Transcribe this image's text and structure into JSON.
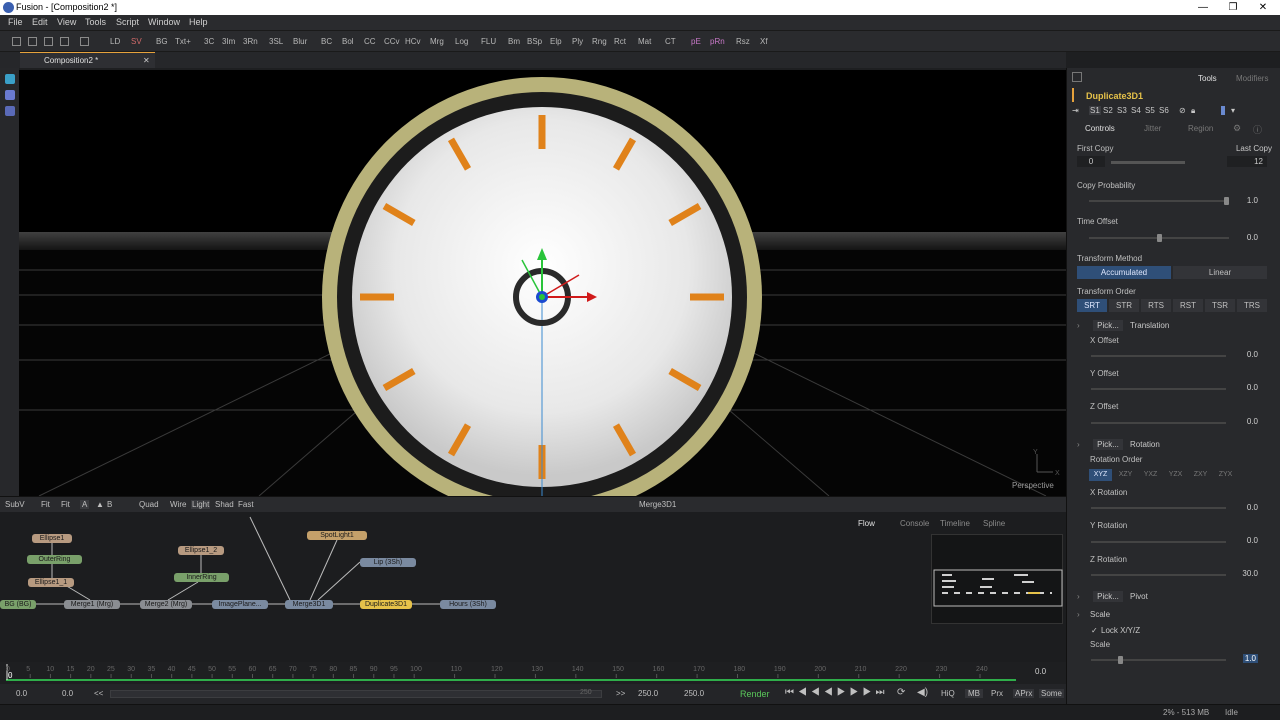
{
  "window": {
    "title": "Fusion - [Composition2 *]",
    "controls": [
      "—",
      "❐",
      "✕"
    ]
  },
  "menu": [
    "File",
    "Edit",
    "View",
    "Tools",
    "Script",
    "Window",
    "Help"
  ],
  "toolbar": [
    "LD",
    "SV",
    "BG",
    "Txt+",
    "3C",
    "3Im",
    "3Rn",
    "3SL",
    "Blur",
    "BC",
    "Bol",
    "CC",
    "CCv",
    "HCv",
    "Mrg",
    "Log",
    "FLU",
    "Bm",
    "BSp",
    "Elp",
    "Ply",
    "Rng",
    "Rct",
    "Mat",
    "CT",
    "pE",
    "pRn",
    "Rsz",
    "Xf"
  ],
  "tab": {
    "label": "Composition2 *",
    "close": "✕"
  },
  "viewport": {
    "mode_label": "Perspective",
    "axis_y": "Y",
    "axis_x": "X"
  },
  "viewer_bar": {
    "subv": "SubV",
    "fit": "Fit",
    "a": "A",
    "b": "B",
    "quad": "Quad",
    "wire": "Wire",
    "light": "Light",
    "shad": "Shad",
    "fast": "Fast",
    "view_name": "Merge3D1"
  },
  "flow": {
    "tabs": {
      "flow": "Flow",
      "console": "Console",
      "timeline": "Timeline",
      "spline": "Spline"
    },
    "nodes": {
      "ellipse1": "Ellipse1",
      "outer_ring": "OuterRing",
      "ellipse1_1": "Ellipse1_1",
      "bg": "BG (BG)",
      "merge1": "Merge1 (Mrg)",
      "ellipse1_2": "Ellipse1_2",
      "inner_ring": "InnerRing",
      "merge2": "Merge2 (Mrg)",
      "image_plane": "ImagePlane...",
      "spotlight": "SpotLight1",
      "lip": "Lip (3Sh)",
      "merge3d": "Merge3D1",
      "duplicate3d": "Duplicate3D1",
      "hours": "Hours (3Sh)"
    }
  },
  "timeline": {
    "ticks": [
      "0",
      "5",
      "10",
      "15",
      "20",
      "25",
      "30",
      "35",
      "40",
      "45",
      "50",
      "55",
      "60",
      "65",
      "70",
      "75",
      "80",
      "85",
      "90",
      "95",
      "100",
      "110",
      "120",
      "130",
      "140",
      "150",
      "160",
      "170",
      "180",
      "190",
      "200",
      "210",
      "220",
      "230",
      "240"
    ],
    "current": "0.0",
    "current_marker": "0"
  },
  "transport": {
    "start": "0.0",
    "global_start": "0.0",
    "rew": "<<",
    "range_end_label": "250",
    "fwd": ">>",
    "render_end": "250.0",
    "global_end": "250.0",
    "render": "Render",
    "hiq": "HiQ",
    "mb": "MB",
    "prx": "Prx",
    "aprx": "APrx",
    "some": "Some"
  },
  "status": {
    "memory": "2% - 513 MB",
    "state": "Idle"
  },
  "panel": {
    "tabs": {
      "tools": "Tools",
      "modifiers": "Modifiers"
    },
    "tool_name": "Duplicate3D1",
    "slots": [
      "S1",
      "S2",
      "S3",
      "S4",
      "S5",
      "S6"
    ],
    "subtabs": {
      "controls": "Controls",
      "jitter": "Jitter",
      "region": "Region"
    },
    "first_copy": {
      "label": "First Copy",
      "value": "0"
    },
    "last_copy": {
      "label": "Last Copy",
      "value": "12"
    },
    "copy_probability": {
      "label": "Copy Probability",
      "value": "1.0",
      "fraction": 1.0
    },
    "time_offset": {
      "label": "Time Offset",
      "value": "0.0",
      "fraction": 0.5
    },
    "transform_method": {
      "label": "Transform Method",
      "options": [
        "Accumulated",
        "Linear"
      ],
      "selected": "Accumulated"
    },
    "transform_order": {
      "label": "Transform Order",
      "options": [
        "SRT",
        "STR",
        "RTS",
        "RST",
        "TSR",
        "TRS"
      ],
      "selected": "SRT"
    },
    "translation": {
      "pick": "Pick...",
      "title": "Translation",
      "x": {
        "label": "X Offset",
        "value": "0.0"
      },
      "y": {
        "label": "Y Offset",
        "value": "0.0"
      },
      "z": {
        "label": "Z Offset",
        "value": "0.0"
      }
    },
    "rotation": {
      "pick": "Pick...",
      "title": "Rotation",
      "order_label": "Rotation Order",
      "orders": [
        "XYZ",
        "XZY",
        "YXZ",
        "YZX",
        "ZXY",
        "ZYX"
      ],
      "selected": "XYZ",
      "x": {
        "label": "X Rotation",
        "value": "0.0"
      },
      "y": {
        "label": "Y Rotation",
        "value": "0.0"
      },
      "z": {
        "label": "Z Rotation",
        "value": "30.0"
      }
    },
    "pivot": {
      "pick": "Pick...",
      "title": "Pivot"
    },
    "scale": {
      "title": "Scale",
      "lock": "Lock X/Y/Z",
      "label": "Scale",
      "value": "1.0"
    }
  },
  "colors": {
    "accent": "#e6a23c",
    "selected": "#2f4f78",
    "clock_rim": "#b8b27a",
    "clock_marks": "#e0821a"
  }
}
